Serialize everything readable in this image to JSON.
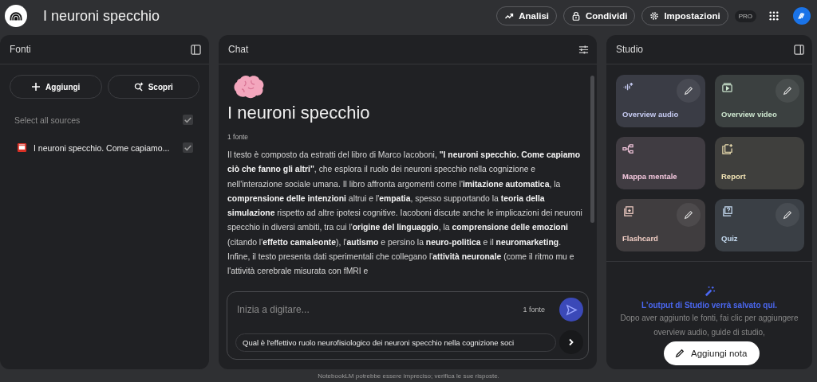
{
  "app": {
    "title": "I neuroni specchio"
  },
  "header_actions": [
    {
      "kind": "analytics",
      "label": "Analisi"
    },
    {
      "kind": "share",
      "label": "Condividi"
    },
    {
      "kind": "settings",
      "label": "Impostazioni"
    }
  ],
  "plan_badge": "PRO",
  "sources_panel": {
    "title": "Fonti",
    "buttons": [
      {
        "kind": "add",
        "label": "Aggiungi"
      },
      {
        "kind": "discover",
        "label": "Scopri"
      }
    ],
    "select_all": {
      "label": "Select all sources",
      "checked": true
    },
    "sources": [
      {
        "name": "I neuroni specchio. Come capiamo...",
        "checked": true
      }
    ]
  },
  "chat_panel": {
    "title": "Chat",
    "notebook_title": "I neuroni specchio",
    "source_count": "1 fonte",
    "summary": "Il testo è composto da estratti del libro di Marco Iacoboni, **\"I neuroni specchio. Come capiamo ciò che fanno gli altri\"**, che esplora il ruolo dei neuroni specchio nella cognizione e nell'interazione sociale umana. Il libro affronta argomenti come l'**imitazione automatica**, la **comprensione delle intenzioni** altrui e l'**empatia**, spesso supportando la **teoria della simulazione** rispetto ad altre ipotesi cognitive. Iacoboni discute anche le implicazioni dei neuroni specchio in diversi ambiti, tra cui l'**origine del linguaggio**, la **comprensione delle emozioni** (citando l'**effetto camaleonte**), l'**autismo** e persino la **neuro-politica** e il **neuromarketing**. Infine, il testo presenta dati sperimentali che collegano l'**attività neuronale** (come il ritmo mu e l'attività cerebrale misurata con fMRI e",
    "input": {
      "placeholder": "Inizia a digitare...",
      "source_count": "1 fonte"
    },
    "suggestion": "Qual è l'effettivo ruolo neurofisiologico dei neuroni specchio nella cognizione soci"
  },
  "studio_panel": {
    "title": "Studio",
    "tools": [
      {
        "kind": "audio",
        "label": "Overview audio",
        "editable": true,
        "color": "#c6cbf2"
      },
      {
        "kind": "video",
        "label": "Overview video",
        "editable": true,
        "color": "#cde6cf"
      },
      {
        "kind": "mindmap",
        "label": "Mappa mentale",
        "editable": false,
        "color": "#f2c6dc"
      },
      {
        "kind": "report",
        "label": "Report",
        "editable": false,
        "color": "#f0e2b4"
      },
      {
        "kind": "flashcard",
        "label": "Flashcard",
        "editable": true,
        "color": "#f2cfc6"
      },
      {
        "kind": "quiz",
        "label": "Quiz",
        "editable": true,
        "color": "#c6dcf2"
      }
    ],
    "empty_title": "L'output di Studio verrà salvato qui.",
    "empty_text": "Dopo aver aggiunto le fonti, fai clic per aggiungere overview audio, guide di studio,",
    "add_note": "Aggiungi nota"
  },
  "footer": "NotebookLM potrebbe essere impreciso; verifica le sue risposte."
}
